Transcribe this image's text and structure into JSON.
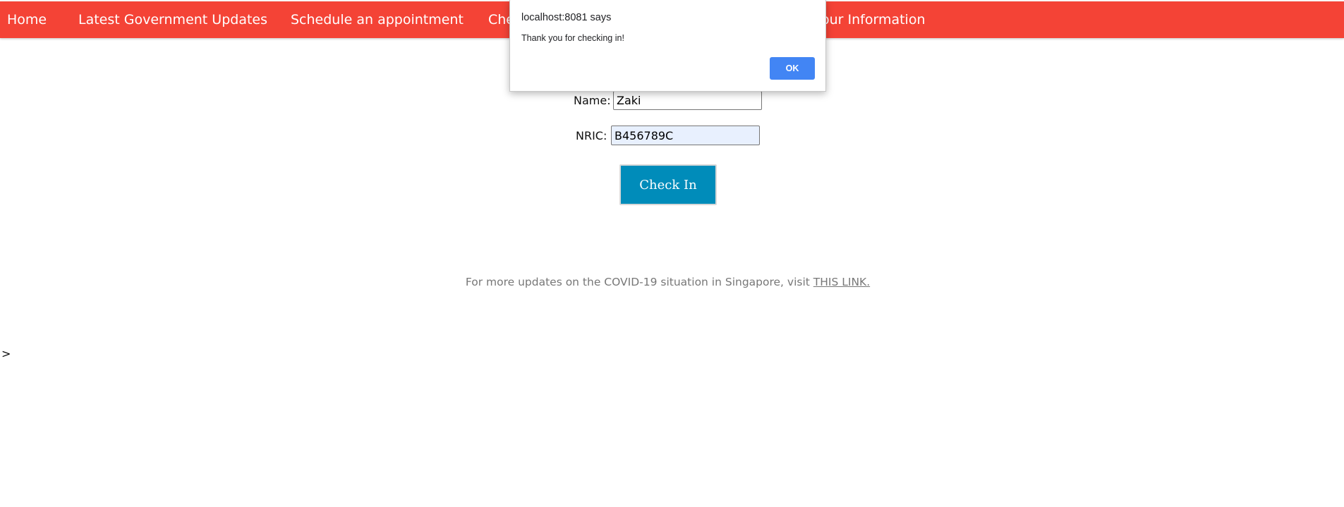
{
  "navbar": {
    "color": "#f44336",
    "items": [
      {
        "label": "Home"
      },
      {
        "label": "Latest Government Updates"
      },
      {
        "label": "Schedule an appointment"
      },
      {
        "label": "Che"
      },
      {
        "label": "our Information"
      }
    ]
  },
  "form": {
    "name_label": "Name:",
    "name_value": "Zaki",
    "nric_label": "NRIC:",
    "nric_value": "B456789C",
    "submit_label": "Check In",
    "button_color": "#008cba"
  },
  "footer": {
    "text": "For more updates on the COVID-19 situation in Singapore, visit ",
    "link_text": "THIS LINK."
  },
  "stray_text": ">",
  "alert": {
    "title": "localhost:8081 says",
    "message": "Thank you for checking in!",
    "ok_label": "OK",
    "button_color": "#4285f4"
  }
}
